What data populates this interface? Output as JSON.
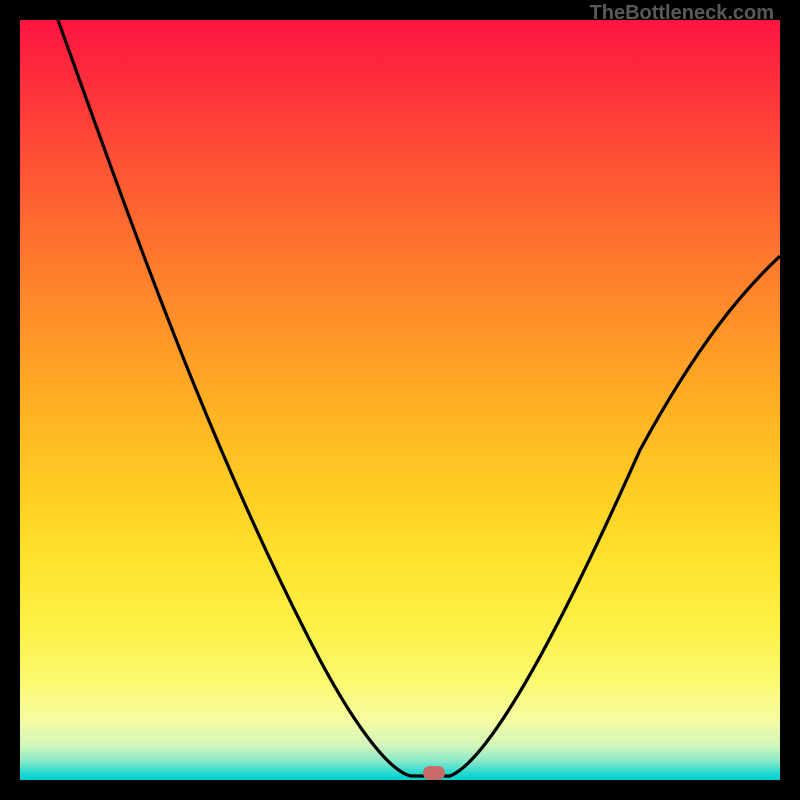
{
  "watermark": "TheBottleneck.com",
  "marker": {
    "x_frac": 0.543,
    "color": "#c86b69"
  },
  "chart_data": {
    "type": "line",
    "title": "",
    "xlabel": "",
    "ylabel": "",
    "xlim": [
      0,
      1
    ],
    "ylim": [
      0,
      1
    ],
    "grid": false,
    "legend": false,
    "background": "vertical-gradient red→yellow→green",
    "series": [
      {
        "name": "left-branch",
        "x": [
          0.05,
          0.1,
          0.15,
          0.2,
          0.25,
          0.3,
          0.35,
          0.4,
          0.45,
          0.5,
          0.515
        ],
        "y": [
          1.0,
          0.86,
          0.735,
          0.62,
          0.51,
          0.405,
          0.305,
          0.21,
          0.12,
          0.03,
          0.005
        ]
      },
      {
        "name": "flat-min",
        "x": [
          0.515,
          0.565
        ],
        "y": [
          0.005,
          0.005
        ]
      },
      {
        "name": "right-branch",
        "x": [
          0.565,
          0.6,
          0.65,
          0.7,
          0.75,
          0.8,
          0.85,
          0.9,
          0.95,
          1.0
        ],
        "y": [
          0.005,
          0.05,
          0.135,
          0.225,
          0.315,
          0.4,
          0.48,
          0.555,
          0.625,
          0.69
        ]
      }
    ],
    "annotations": [
      {
        "kind": "marker",
        "x": 0.543,
        "y": 0.005,
        "shape": "rounded-rect",
        "color": "#c86b69"
      }
    ]
  }
}
